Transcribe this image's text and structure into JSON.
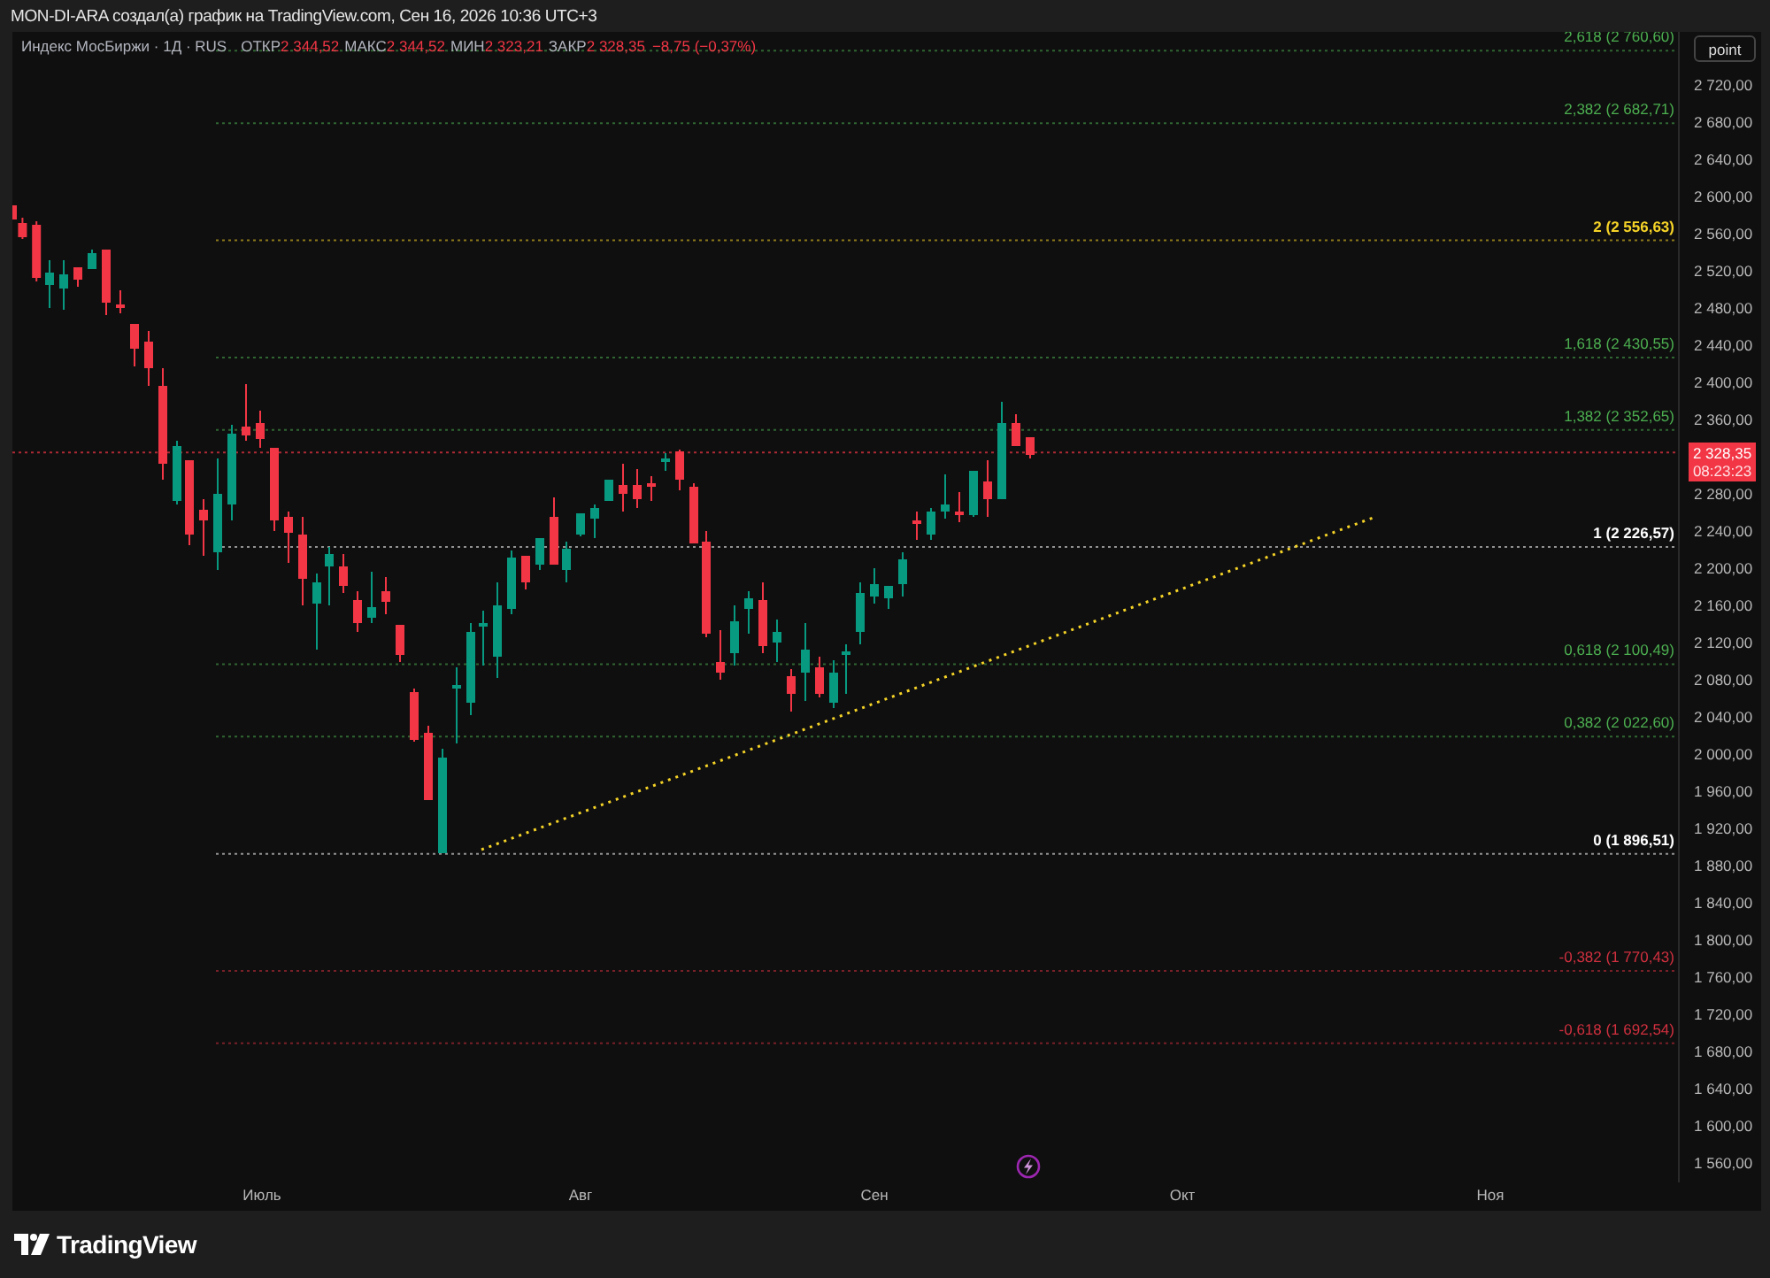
{
  "header": {
    "title": "MON-DI-ARA создал(а) график на TradingView.com, Сен 16, 2026 10:36 UTC+3"
  },
  "legend": {
    "symbol": "Индекс МосБиржи · 1Д · RUS",
    "fields": [
      {
        "label": "ОТКР",
        "value": "2 344,52"
      },
      {
        "label": "МАКС",
        "value": "2 344,52"
      },
      {
        "label": "МИН",
        "value": "2 323,21"
      },
      {
        "label": "ЗАКР",
        "value": "2 328,35"
      }
    ],
    "change": "−8,75 (−0,37%)"
  },
  "scale_button": {
    "label": "point"
  },
  "fib_levels": [
    {
      "label": "2,618 (2 760,60)",
      "color": "#4caf50",
      "kind": "level"
    },
    {
      "label": "2,382 (2 682,71)",
      "color": "#4caf50",
      "kind": "level"
    },
    {
      "label": "2 (2 556,63)",
      "color": "#f5d327",
      "kind": "key"
    },
    {
      "label": "1,618 (2 430,55)",
      "color": "#4caf50",
      "kind": "level"
    },
    {
      "label": "1,382 (2 352,65)",
      "color": "#4caf50",
      "kind": "level"
    },
    {
      "label": "1 (2 226,57)",
      "color": "#ffffff",
      "kind": "key"
    },
    {
      "label": "0,618 (2 100,49)",
      "color": "#4caf50",
      "kind": "level"
    },
    {
      "label": "0,382 (2 022,60)",
      "color": "#4caf50",
      "kind": "level"
    },
    {
      "label": "0 (1 896,51)",
      "color": "#ffffff",
      "kind": "key"
    },
    {
      "label": "-0,382 (1 770,43)",
      "color": "#d1303f",
      "kind": "level"
    },
    {
      "label": "-0,618 (1 692,54)",
      "color": "#d1303f",
      "kind": "level"
    }
  ],
  "price_axis": {
    "ticks": [
      "2 720,00",
      "2 680,00",
      "2 640,00",
      "2 600,00",
      "2 560,00",
      "2 520,00",
      "2 480,00",
      "2 440,00",
      "2 400,00",
      "2 360,00",
      "2 280,00",
      "2 240,00",
      "2 200,00",
      "2 160,00",
      "2 120,00",
      "2 080,00",
      "2 040,00",
      "2 000,00",
      "1 960,00",
      "1 920,00",
      "1 880,00",
      "1 840,00",
      "1 800,00",
      "1 760,00",
      "1 720,00",
      "1 680,00",
      "1 640,00",
      "1 600,00",
      "1 560,00"
    ]
  },
  "last_price": {
    "price": "2 328,35",
    "countdown": "08:23:23"
  },
  "time_axis": {
    "labels": [
      "Июль",
      "Авг",
      "Сен",
      "Окт",
      "Ноя"
    ]
  },
  "footer": {
    "brand": "TradingView"
  }
}
